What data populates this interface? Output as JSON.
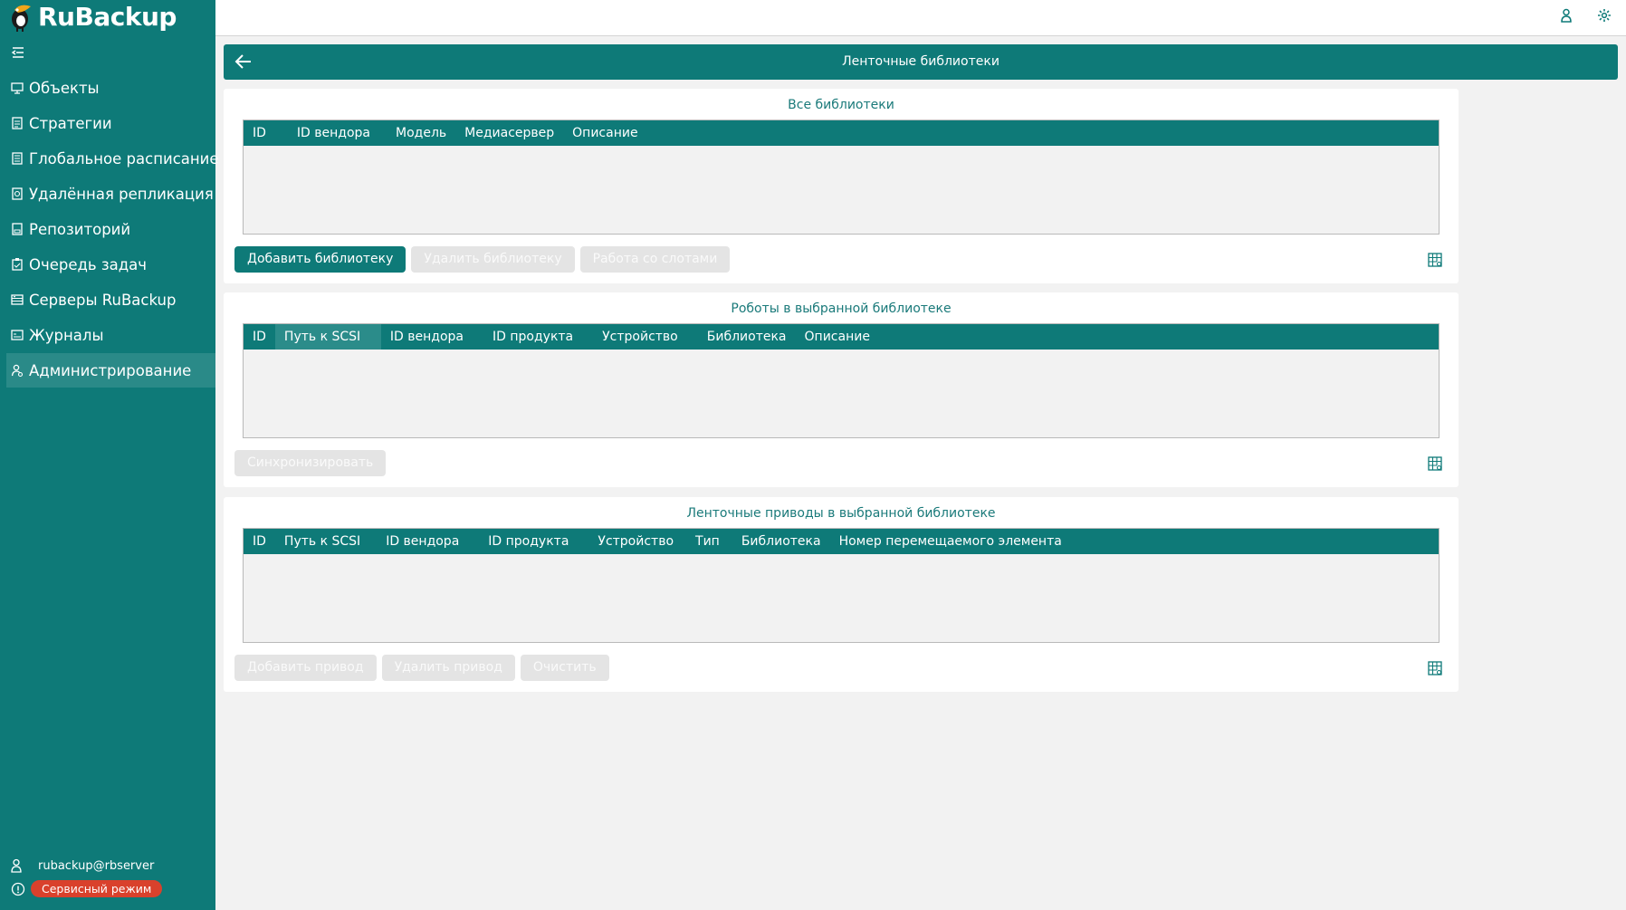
{
  "app": {
    "logo_text": "RuBackup"
  },
  "sidebar": {
    "items": [
      {
        "label": "Объекты",
        "icon": "monitor-icon"
      },
      {
        "label": "Стратегии",
        "icon": "document-icon"
      },
      {
        "label": "Глобальное расписание",
        "icon": "calendar-icon"
      },
      {
        "label": "Удалённая репликация",
        "icon": "replication-icon"
      },
      {
        "label": "Репозиторий",
        "icon": "repository-icon"
      },
      {
        "label": "Очередь задач",
        "icon": "clipboard-icon"
      },
      {
        "label": "Серверы RuBackup",
        "icon": "server-icon"
      },
      {
        "label": "Журналы",
        "icon": "log-icon"
      },
      {
        "label": "Администрирование",
        "icon": "admin-icon"
      }
    ],
    "active_index": 8,
    "user": "rubackup@rbserver",
    "mode_badge": "Сервисный режим"
  },
  "header": {
    "title": "Ленточные библиотеки"
  },
  "panels": {
    "libraries": {
      "title": "Все библиотеки",
      "columns": [
        "ID",
        "ID вендора",
        "Модель",
        "Медиасервер",
        "Описание"
      ],
      "buttons": {
        "add": "Добавить библиотеку",
        "delete": "Удалить библиотеку",
        "slots": "Работа со слотами"
      }
    },
    "robots": {
      "title": "Роботы в выбранной библиотеке",
      "columns": [
        "ID",
        "Путь к SCSI",
        "ID вендора",
        "ID продукта",
        "Устройство",
        "Библиотека",
        "Описание"
      ],
      "buttons": {
        "sync": "Синхронизировать"
      }
    },
    "drives": {
      "title": "Ленточные приводы в выбранной библиотеке",
      "columns": [
        "ID",
        "Путь к SCSI",
        "ID вендора",
        "ID продукта",
        "Устройство",
        "Тип",
        "Библиотека",
        "Номер перемещаемого элемента"
      ],
      "buttons": {
        "add": "Добавить привод",
        "delete": "Удалить привод",
        "clear": "Очистить"
      }
    }
  },
  "colors": {
    "accent": "#0e7a78",
    "badge": "#d9412c"
  }
}
